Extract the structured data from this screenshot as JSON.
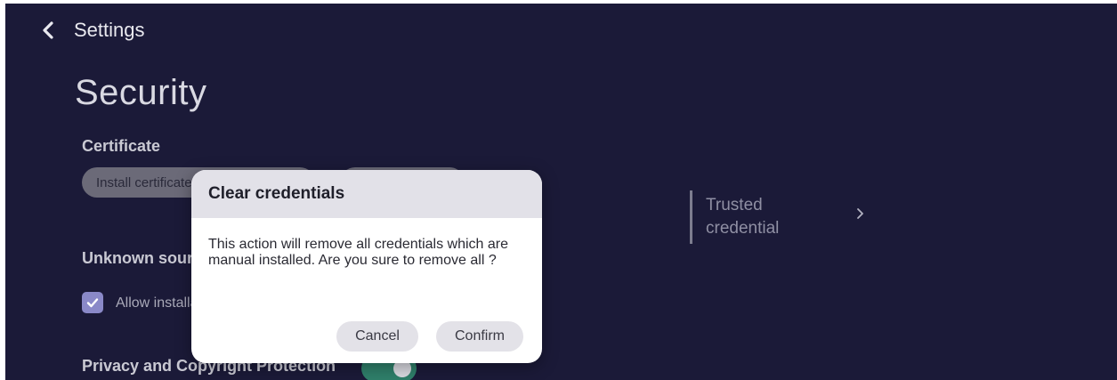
{
  "header": {
    "back_icon": "chevron-left-icon",
    "title": "Settings"
  },
  "page": {
    "title": "Security"
  },
  "certificate": {
    "label": "Certificate",
    "install_button": "Install certificate",
    "second_button": ""
  },
  "unknown_sources": {
    "label": "Unknown sources",
    "checkbox_label": "Allow installation",
    "checked": true
  },
  "privacy": {
    "label": "Privacy and Copyright Protection",
    "toggle_on": true
  },
  "trusted_credential": {
    "label": "Trusted credential",
    "chevron_icon": "chevron-right-icon"
  },
  "dialog": {
    "title": "Clear credentials",
    "message": "This action will remove all credentials which are manual installed. Are you sure to remove all ?",
    "cancel_label": "Cancel",
    "confirm_label": "Confirm"
  },
  "colors": {
    "background": "#1b1a38",
    "toggle_on": "#2f7f6a",
    "checkbox": "#8a89c8"
  }
}
